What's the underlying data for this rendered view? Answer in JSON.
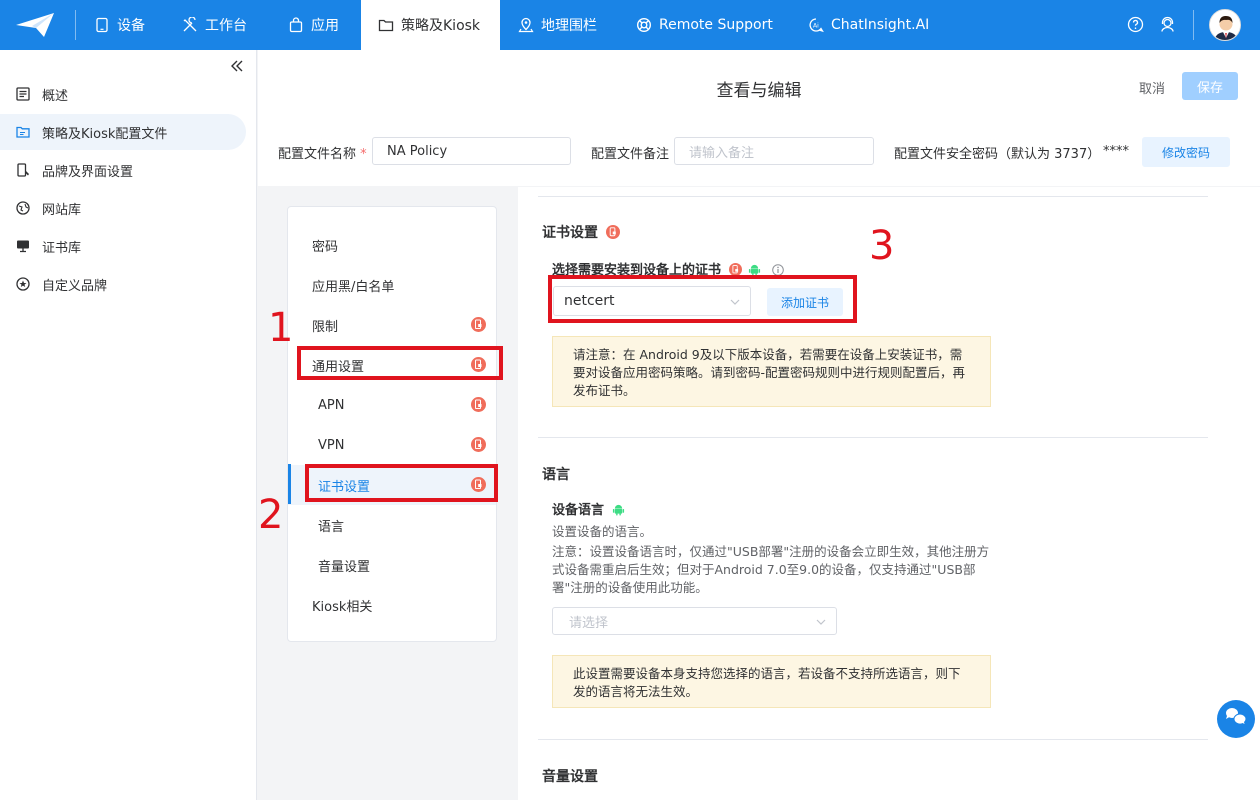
{
  "topbar": {
    "nav": [
      {
        "label": "设备",
        "icon": "tablet-icon"
      },
      {
        "label": "工作台",
        "icon": "tools-icon"
      },
      {
        "label": "应用",
        "icon": "bag-icon"
      },
      {
        "label": "策略及Kiosk",
        "icon": "folder-icon",
        "active": true
      },
      {
        "label": "地理围栏",
        "icon": "map-pin-icon"
      },
      {
        "label": "Remote Support",
        "icon": "lifebuoy-icon"
      },
      {
        "label": "ChatInsight.AI",
        "icon": "chat-ai-icon"
      }
    ],
    "right_icons": [
      "help-icon",
      "support-agent-icon"
    ]
  },
  "sidebar": {
    "items": [
      {
        "label": "概述",
        "icon": "list-icon"
      },
      {
        "label": "策略及Kiosk配置文件",
        "icon": "folder-policy-icon",
        "active": true
      },
      {
        "label": "品牌及界面设置",
        "icon": "phone-brush-icon"
      },
      {
        "label": "网站库",
        "icon": "globe-icon"
      },
      {
        "label": "证书库",
        "icon": "monitor-icon"
      },
      {
        "label": "自定义品牌",
        "icon": "star-circle-icon"
      }
    ]
  },
  "header": {
    "title": "查看与编辑",
    "cancel": "取消",
    "save": "保存",
    "name_label": "配置文件名称",
    "required_mark": "*",
    "name_value": "NA Policy",
    "note_label": "配置文件备注",
    "note_placeholder": "请输入备注",
    "pw_label": "配置文件安全密码（默认为 3737）",
    "pw_mask": "****",
    "pw_button": "修改密码"
  },
  "menu": {
    "items": [
      {
        "label": "密码",
        "type": "top",
        "badge": false
      },
      {
        "label": "应用黑/白名单",
        "type": "top",
        "badge": false
      },
      {
        "label": "限制",
        "type": "top",
        "badge": true
      },
      {
        "label": "通用设置",
        "type": "top",
        "badge": true
      },
      {
        "label": "APN",
        "type": "sub",
        "badge": true
      },
      {
        "label": "VPN",
        "type": "sub",
        "badge": true
      },
      {
        "label": "证书设置",
        "type": "sub",
        "badge": true,
        "active": true
      },
      {
        "label": "语言",
        "type": "sub",
        "badge": false
      },
      {
        "label": "音量设置",
        "type": "sub",
        "badge": false
      },
      {
        "label": "Kiosk相关",
        "type": "top",
        "badge": false
      }
    ]
  },
  "annotations": {
    "one": "1",
    "two": "2",
    "three": "3"
  },
  "cert": {
    "section_title": "证书设置",
    "select_label": "选择需要安装到设备上的证书",
    "selected": "netcert",
    "add_button": "添加证书",
    "notice": "请注意：在 Android 9及以下版本设备，若需要在设备上安装证书，需要对设备应用密码策略。请到密码-配置密码规则中进行规则配置后，再发布证书。"
  },
  "language": {
    "section_title": "语言",
    "field_label": "设备语言",
    "desc1": "设置设备的语言。",
    "desc2": "注意：设置设备语言时，仅通过\"USB部署\"注册的设备会立即生效，其他注册方式设备需重启后生效；但对于Android 7.0至9.0的设备，仅支持通过\"USB部署\"注册的设备使用此功能。",
    "placeholder": "请选择",
    "notice": "此设置需要设备本身支持您选择的语言，若设备不支持所选语言，则下发的语言将无法生效。"
  },
  "volume": {
    "section_title": "音量设置"
  },
  "colors": {
    "brand": "#1a84e6",
    "annotation_red": "#e0141e",
    "badge": "#f06d5b",
    "android_green": "#3ddc84"
  }
}
